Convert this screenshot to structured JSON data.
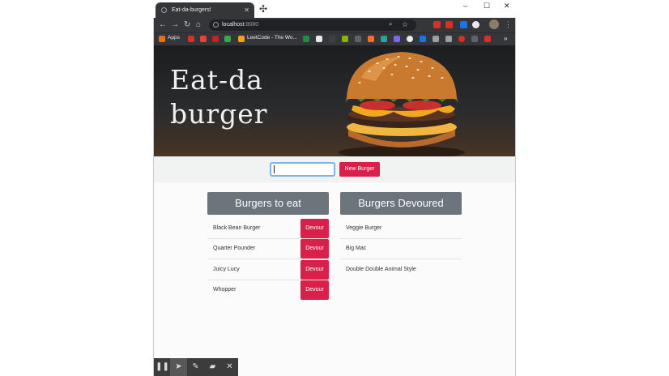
{
  "browser": {
    "tab_title": "Eat-da-burgers!",
    "tab_close": "✕",
    "new_tab_icon": "✣",
    "window_controls": [
      "–",
      "☐",
      "✕"
    ],
    "url_host": "localhost",
    "url_port": ":8080",
    "bookmarks": [
      {
        "label": "Apps",
        "color": "#e8710a"
      },
      {
        "label": "LeetCode - The Wo...",
        "color": "#f89f1b"
      }
    ]
  },
  "hero": {
    "title": "Eat-da burger"
  },
  "form": {
    "input_value": "",
    "new_burger_label": "New Burger"
  },
  "burgers_to_eat": {
    "heading": "Burgers to eat",
    "items": [
      {
        "name": "Black Bean Burger",
        "action": "Devour"
      },
      {
        "name": "Quarter Pounder",
        "action": "Devour"
      },
      {
        "name": "Juicy Lucy",
        "action": "Devour"
      },
      {
        "name": "Whopper",
        "action": "Devour"
      }
    ]
  },
  "burgers_devoured": {
    "heading": "Burgers Devoured",
    "items": [
      {
        "name": "Veggie Burger"
      },
      {
        "name": "Big Mac"
      },
      {
        "name": "Double Double Animal Style"
      }
    ]
  },
  "recorder_controls": [
    "pause-icon",
    "cursor-icon",
    "pen-icon",
    "eraser-icon",
    "close-icon"
  ],
  "colors": {
    "accent_red": "#d9204b",
    "heading_gray": "#6b757b",
    "browser_dark": "#35363a"
  }
}
